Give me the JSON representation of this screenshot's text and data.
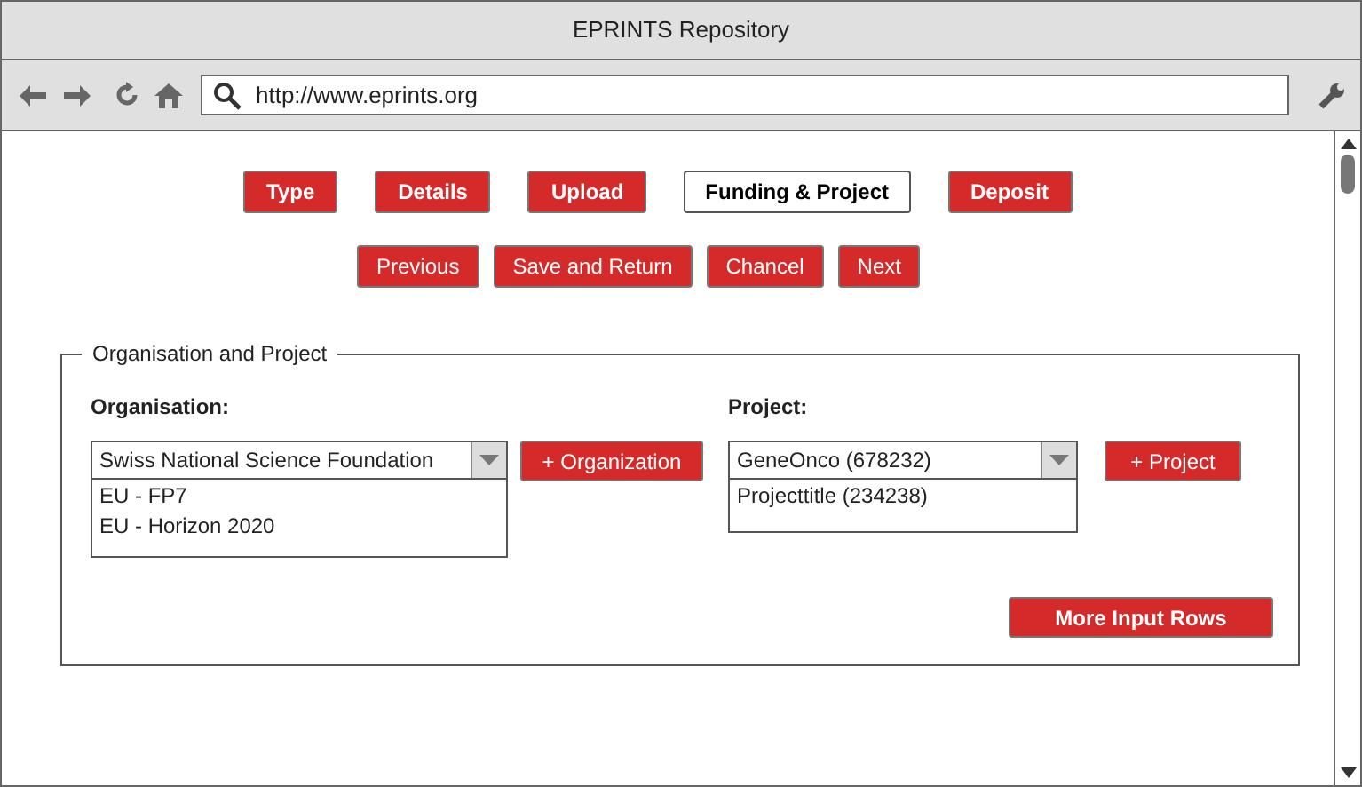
{
  "window": {
    "title": "EPRINTS Repository"
  },
  "toolbar": {
    "url": "http://www.eprints.org"
  },
  "steps": [
    {
      "label": "Type",
      "selected": false
    },
    {
      "label": "Details",
      "selected": false
    },
    {
      "label": "Upload",
      "selected": false
    },
    {
      "label": "Funding & Project",
      "selected": true
    },
    {
      "label": "Deposit",
      "selected": false
    }
  ],
  "nav_buttons": [
    "Previous",
    "Save and Return",
    "Chancel",
    "Next"
  ],
  "section": {
    "legend": "Organisation and Project",
    "organisation": {
      "label": "Organisation:",
      "value": "Swiss National Science Foundation",
      "options": [
        "EU - FP7",
        "EU - Horizon 2020"
      ],
      "add_button": "+ Organization"
    },
    "project": {
      "label": "Project:",
      "value": "GeneOnco (678232)",
      "options": [
        "Projecttitle (234238)"
      ],
      "add_button": "+ Project"
    },
    "more_button": "More Input Rows"
  }
}
